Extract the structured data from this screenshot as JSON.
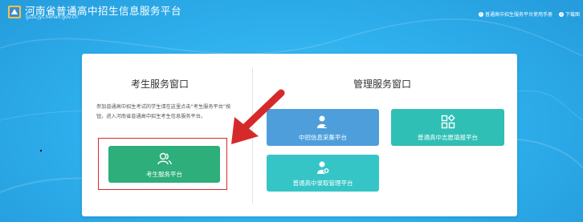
{
  "header": {
    "site_title": "河南省普通高中招生信息服务平台",
    "site_url": "gzzs.jyt.henan.gov.cn",
    "links": [
      {
        "icon": "info-circle-icon",
        "label": "普通高中招生服务平台使用手册"
      },
      {
        "icon": "download-icon",
        "label": "下载图"
      }
    ]
  },
  "student_section": {
    "title": "考生服务窗口",
    "notice": "参加普通高中招生考试的学生请在这里点击“考生服务平台”按钮，进入河南省普通高中招生考生信息服务平台。",
    "button_label": "考生服务平台",
    "button_icon": "users-icon"
  },
  "management_section": {
    "title": "管理服务窗口",
    "buttons": [
      {
        "label": "中招信息采集平台",
        "icon": "user-edit-icon"
      },
      {
        "label": "普通高中志愿填报平台",
        "icon": "apps-grid-icon"
      },
      {
        "label": "普通高中录取管理平台",
        "icon": "user-add-icon"
      }
    ]
  },
  "colors": {
    "background": "#2aa6e6",
    "student_button": "#2dae7a",
    "collect_button": "#4d9edb",
    "enroll_manage_button": "#2fbfb5",
    "admission_button": "#36c5c7",
    "annotation_red": "#d62a2a"
  }
}
